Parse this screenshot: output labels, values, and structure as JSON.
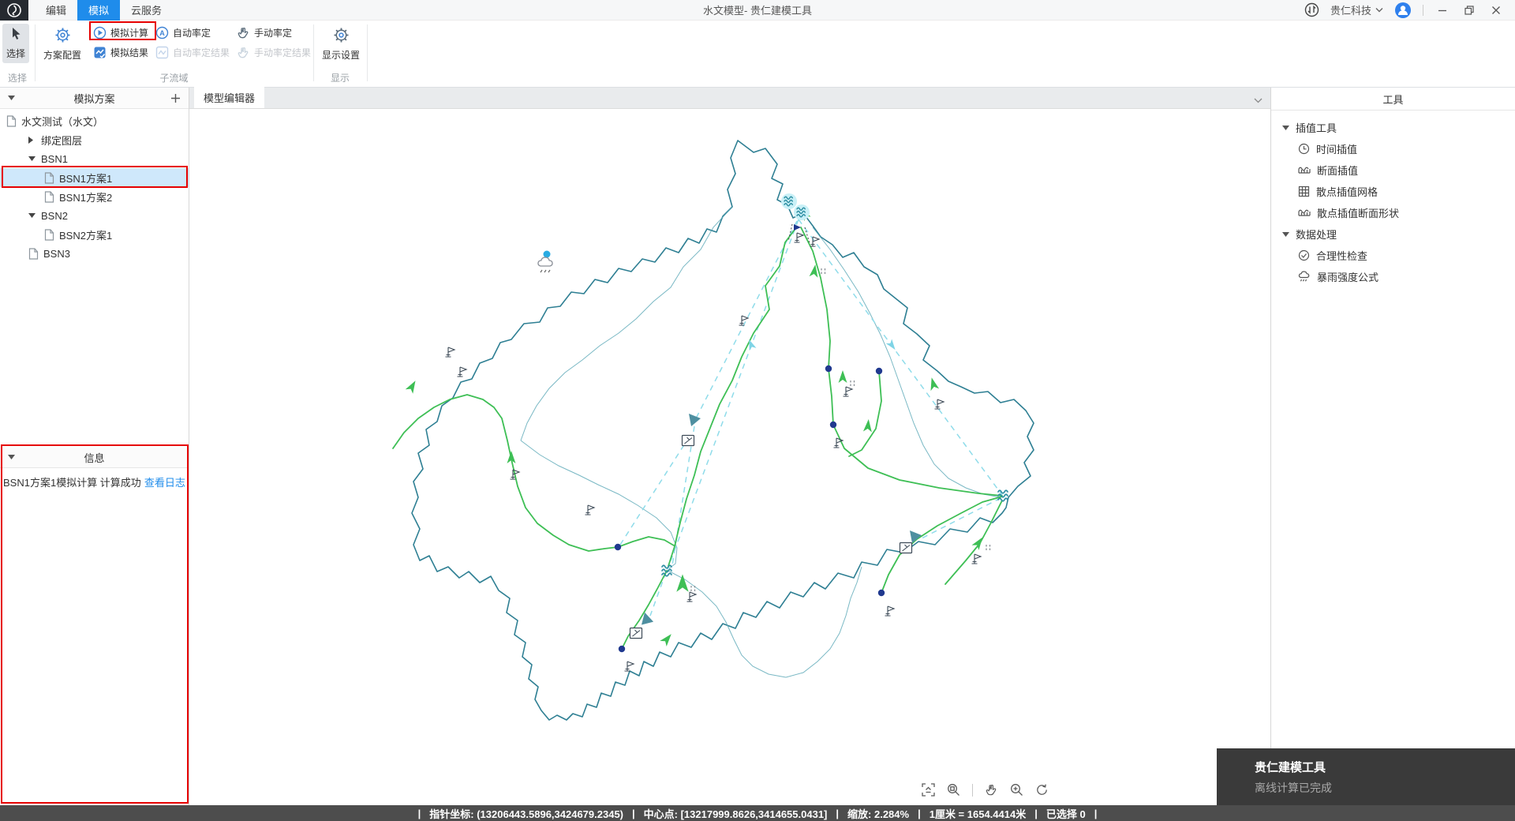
{
  "colors": {
    "accent": "#1890ff",
    "annotation": "#e60000",
    "basin": "#2e7f93",
    "basinInner": "#58a6b5",
    "river": "#3ebf55",
    "link": "#8fdcea",
    "linkArrow": "#7fd4e6",
    "node": "#20398f",
    "station": "#3d4a57",
    "structure": "#4e8fa0",
    "outlet": "#2e8fa3",
    "statusBg": "#4d4d4d",
    "toastBg": "#3a3a3a",
    "ribbonIcon": "#3f83d4",
    "selectedRow": "#cfe8fb",
    "rain": "#29abe2"
  },
  "titlebar": {
    "title": "水文模型- 贵仁建模工具",
    "menus": [
      {
        "label": "编辑"
      },
      {
        "label": "模拟"
      },
      {
        "label": "云服务"
      }
    ],
    "org": "贵仁科技"
  },
  "ribbon": {
    "select": {
      "label": "选择"
    },
    "config": {
      "label": "方案配置"
    },
    "simCalc": {
      "label": "模拟计算"
    },
    "simResult": {
      "label": "模拟结果"
    },
    "autoCal": {
      "label": "自动率定"
    },
    "autoCalResult": {
      "label": "自动率定结果"
    },
    "manualCal": {
      "label": "手动率定"
    },
    "manualCalResult": {
      "label": "手动率定结果"
    },
    "displaySettings": {
      "label": "显示设置"
    },
    "groupSelect": "选择",
    "groupSubbasin": "子流域",
    "groupDisplay": "显示"
  },
  "sidebar": {
    "header": "模拟方案",
    "tree": [
      {
        "label": "水文测试（水文）"
      },
      {
        "label": "绑定图层"
      },
      {
        "label": "BSN1"
      },
      {
        "label": "BSN1方案1"
      },
      {
        "label": "BSN1方案2"
      },
      {
        "label": "BSN2"
      },
      {
        "label": "BSN2方案1"
      },
      {
        "label": "BSN3"
      }
    ]
  },
  "infoPanel": {
    "header": "信息",
    "message": "BSN1方案1模拟计算 计算成功",
    "link": "查看日志"
  },
  "editor": {
    "tab": "模型编辑器"
  },
  "toolsPanel": {
    "header": "工具",
    "groups": [
      {
        "label": "插值工具",
        "items": [
          {
            "label": "时间插值"
          },
          {
            "label": "断面插值"
          },
          {
            "label": "散点插值网格"
          },
          {
            "label": "散点插值断面形状"
          }
        ]
      },
      {
        "label": "数据处理",
        "items": [
          {
            "label": "合理性检查"
          },
          {
            "label": "暴雨强度公式"
          }
        ]
      }
    ]
  },
  "statusbar": {
    "sep": "|",
    "segments": [
      "指针坐标: (13206443.5896,3424679.2345)",
      "中心点: [13217999.8626,3414655.0431]",
      "缩放: 2.284%",
      "1厘米 = 1654.4414米",
      "已选择 0"
    ]
  },
  "toast": {
    "title": "贵仁建模工具",
    "message": "离线计算已完成"
  }
}
